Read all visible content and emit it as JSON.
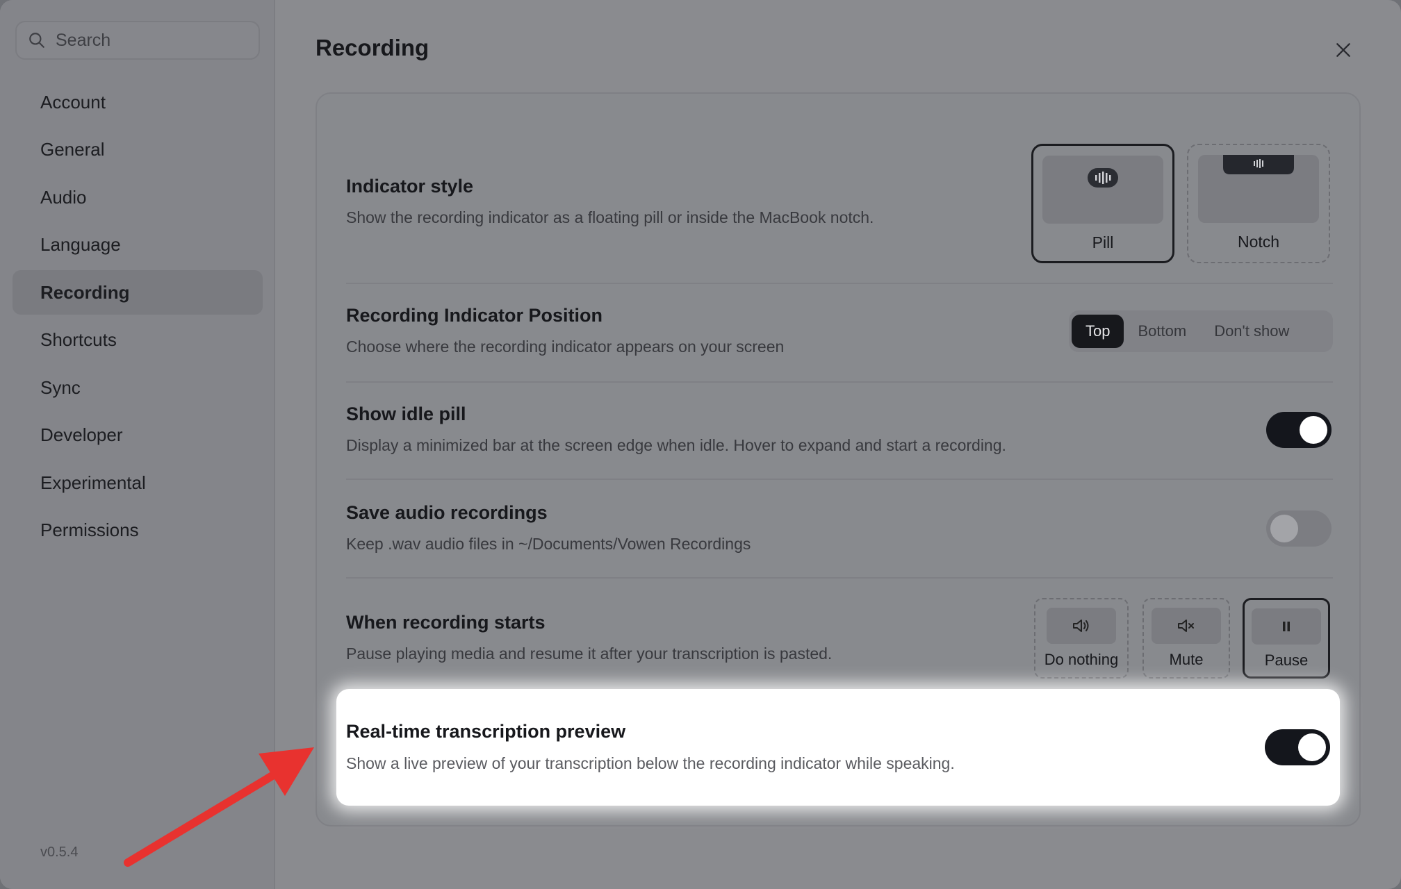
{
  "search": {
    "placeholder": "Search"
  },
  "sidebar": {
    "items": [
      {
        "label": "Account"
      },
      {
        "label": "General"
      },
      {
        "label": "Audio"
      },
      {
        "label": "Language"
      },
      {
        "label": "Recording"
      },
      {
        "label": "Shortcuts"
      },
      {
        "label": "Sync"
      },
      {
        "label": "Developer"
      },
      {
        "label": "Experimental"
      },
      {
        "label": "Permissions"
      }
    ],
    "active": "Recording",
    "version": "v0.5.4"
  },
  "main": {
    "title": "Recording",
    "indicator_style": {
      "title": "Indicator style",
      "desc": "Show the recording indicator as a floating pill or inside the MacBook notch.",
      "options": [
        {
          "label": "Pill",
          "selected": true
        },
        {
          "label": "Notch",
          "selected": false
        }
      ]
    },
    "indicator_position": {
      "title": "Recording Indicator Position",
      "desc": "Choose where the recording indicator appears on your screen",
      "options": [
        "Top",
        "Bottom",
        "Don't show"
      ],
      "selected": "Top"
    },
    "idle_pill": {
      "title": "Show idle pill",
      "desc": "Display a minimized bar at the screen edge when idle. Hover to expand and start a recording.",
      "enabled": true
    },
    "save_audio": {
      "title": "Save audio recordings",
      "desc": "Keep .wav audio files in ~/Documents/Vowen Recordings",
      "enabled": false
    },
    "when_recording": {
      "title": "When recording starts",
      "desc": "Pause playing media and resume it after your transcription is pasted.",
      "options": [
        {
          "label": "Do nothing"
        },
        {
          "label": "Mute"
        },
        {
          "label": "Pause"
        }
      ],
      "selected": "Pause"
    },
    "realtime_preview": {
      "title": "Real-time transcription preview",
      "desc": "Show a live preview of your transcription below the recording indicator while speaking.",
      "enabled": true
    }
  },
  "colors": {
    "accent": "#14161c",
    "annotation_arrow": "#e8322f",
    "highlight_bg": "#ffffff"
  }
}
